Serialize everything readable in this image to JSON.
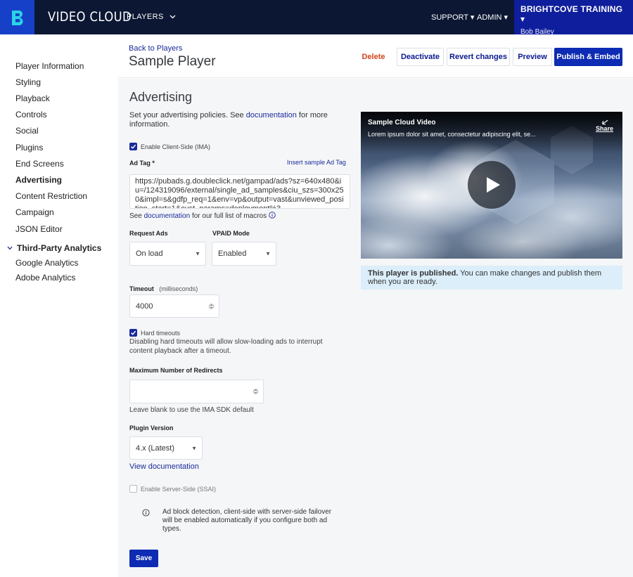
{
  "topnav": {
    "brand": "VIDEO CLOUD",
    "players_label": "PLAYERS",
    "support_label": "SUPPORT",
    "admin_label": "ADMIN",
    "account_name": "BRIGHTCOVE TRAINING",
    "account_user": "Bob Bailey",
    "logo_letter": "B"
  },
  "sidebar": {
    "items": [
      {
        "label": "Player Information"
      },
      {
        "label": "Styling"
      },
      {
        "label": "Playback"
      },
      {
        "label": "Controls"
      },
      {
        "label": "Social"
      },
      {
        "label": "Plugins"
      },
      {
        "label": "End Screens"
      },
      {
        "label": "Advertising"
      },
      {
        "label": "Content Restriction"
      },
      {
        "label": "Campaign"
      },
      {
        "label": "JSON Editor"
      }
    ],
    "section_label": "Third-Party Analytics",
    "sub_items": [
      {
        "label": "Google Analytics"
      },
      {
        "label": "Adobe Analytics"
      }
    ]
  },
  "header": {
    "back_link": "Back to Players",
    "title": "Sample Player",
    "delete": "Delete",
    "deactivate": "Deactivate",
    "revert": "Revert changes",
    "preview": "Preview",
    "publish": "Publish & Embed"
  },
  "advertising": {
    "heading": "Advertising",
    "desc_prefix": "Set your advertising policies. See ",
    "desc_link": "documentation",
    "desc_suffix": " for more information.",
    "client_side_label": "Enable Client-Side (IMA)",
    "ad_tag_label": "Ad Tag *",
    "insert_sample": "Insert sample Ad Tag",
    "ad_tag_value": "https://pubads.g.doubleclick.net/gampad/ads?sz=640x480&iu=/124319096/external/single_ad_samples&ciu_szs=300x250&impl=s&gdfp_req=1&env=vp&output=vast&unviewed_position_start=1&cust_params=deployment%3",
    "macros_prefix": "See ",
    "macros_link": "documentation",
    "macros_suffix": " for our full list of macros",
    "request_ads_label": "Request Ads",
    "request_ads_value": "On load",
    "vpaid_label": "VPAID Mode",
    "vpaid_value": "Enabled",
    "timeout_label": "Timeout",
    "timeout_unit": "(milliseconds)",
    "timeout_value": "4000",
    "hard_timeouts_label": "Hard timeouts",
    "hard_timeouts_help": "Disabling hard timeouts will allow slow-loading ads to interrupt content playback after a timeout.",
    "max_redirects_label": "Maximum Number of Redirects",
    "max_redirects_value": "",
    "max_redirects_help": "Leave blank to use the IMA SDK default",
    "plugin_version_label": "Plugin Version",
    "plugin_version_value": "4.x (Latest)",
    "view_docs": "View documentation",
    "server_side_label": "Enable Server-Side (SSAI)",
    "info_text": "Ad block detection, client-side with server-side failover will be enabled automatically if you configure both ad types.",
    "save": "Save"
  },
  "player": {
    "video_title": "Sample Cloud Video",
    "video_desc": "Lorem ipsum dolor sit amet, consectetur adipiscing elit, se...",
    "share": "Share",
    "published_bold": "This player is published.",
    "published_rest": " You can make changes and publish them when you are ready."
  }
}
